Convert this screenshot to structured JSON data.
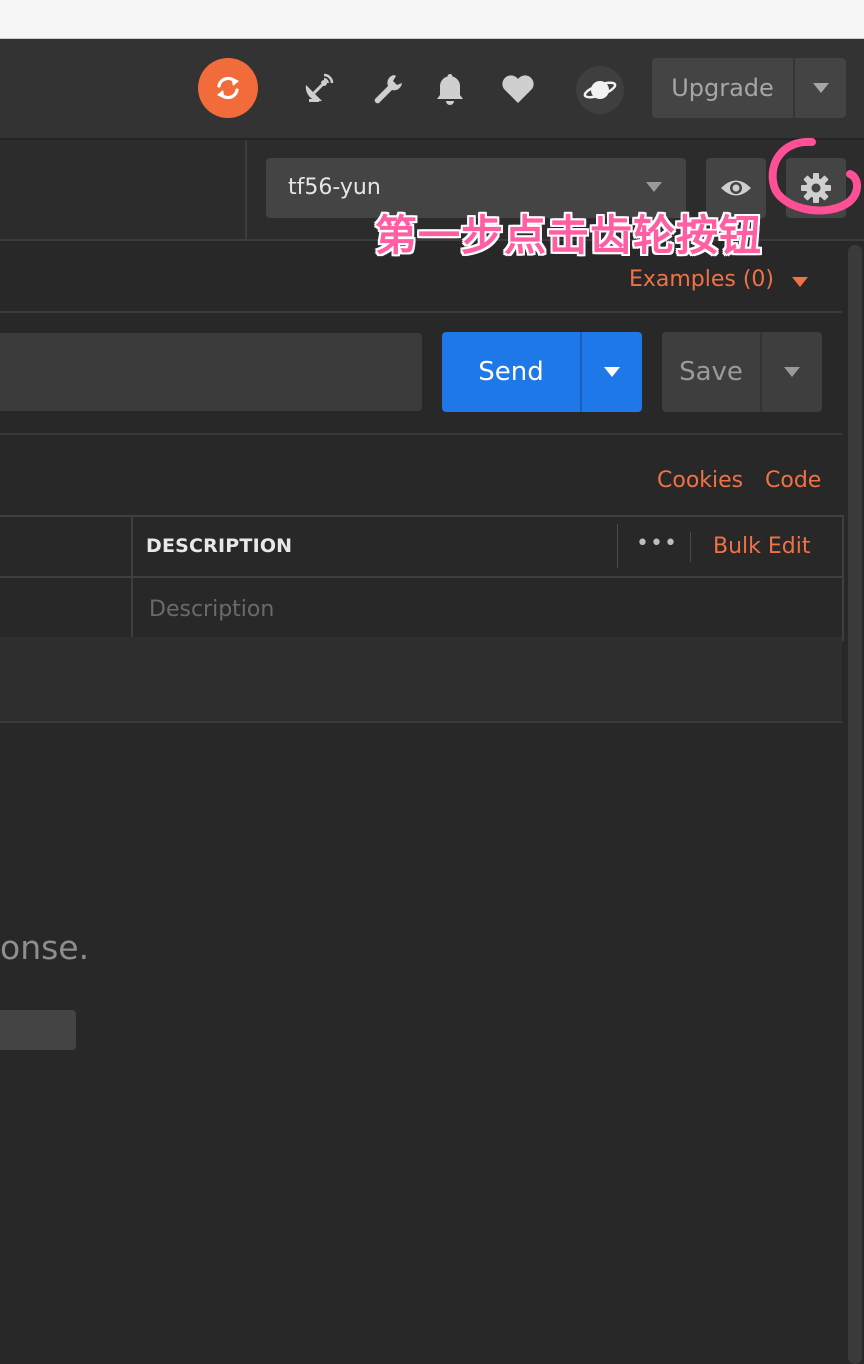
{
  "header": {
    "upgrade_label": "Upgrade"
  },
  "environment": {
    "selected": "tf56-yun"
  },
  "annotation": {
    "text": "第一步点击齿轮按钮",
    "color": "#ff5fa2"
  },
  "request": {
    "examples_label": "Examples (0)",
    "send_label": "Send",
    "save_label": "Save",
    "cookies_label": "Cookies",
    "code_label": "Code"
  },
  "params_table": {
    "description_header": "DESCRIPTION",
    "more_label": "•••",
    "bulk_edit_label": "Bulk Edit",
    "description_placeholder": "Description"
  },
  "response": {
    "partial_text": "onse."
  },
  "colors": {
    "accent_orange": "#f07145",
    "send_blue": "#1f78e8",
    "sync_orange": "#f26b3a"
  },
  "icons": [
    "sync-icon",
    "satellite-icon",
    "wrench-icon",
    "bell-icon",
    "heart-icon",
    "planet-icon",
    "eye-icon",
    "gear-icon"
  ]
}
